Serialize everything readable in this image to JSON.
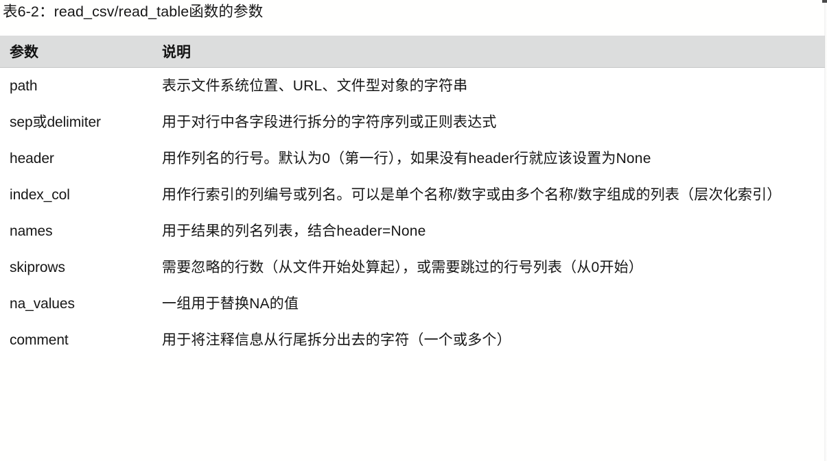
{
  "caption": "表6-2：read_csv/read_table函数的参数",
  "table": {
    "header": {
      "param": "参数",
      "description": "说明"
    },
    "header_background": "#dcdddd",
    "rows": [
      {
        "param": "path",
        "description": "表示文件系统位置、URL、文件型对象的字符串"
      },
      {
        "param": "sep或delimiter",
        "description": "用于对行中各字段进行拆分的字符序列或正则表达式"
      },
      {
        "param": "header",
        "description": "用作列名的行号。默认为0（第一行），如果没有header行就应该设置为None"
      },
      {
        "param": "index_col",
        "description": "用作行索引的列编号或列名。可以是单个名称/数字或由多个名称/数字组成的列表（层次化索引）"
      },
      {
        "param": "names",
        "description": "用于结果的列名列表，结合header=None"
      },
      {
        "param": "skiprows",
        "description": "需要忽略的行数（从文件开始处算起），或需要跳过的行号列表（从0开始）"
      },
      {
        "param": "na_values",
        "description": "一组用于替换NA的值"
      },
      {
        "param": "comment",
        "description": "用于将注释信息从行尾拆分出去的字符（一个或多个）"
      }
    ]
  }
}
